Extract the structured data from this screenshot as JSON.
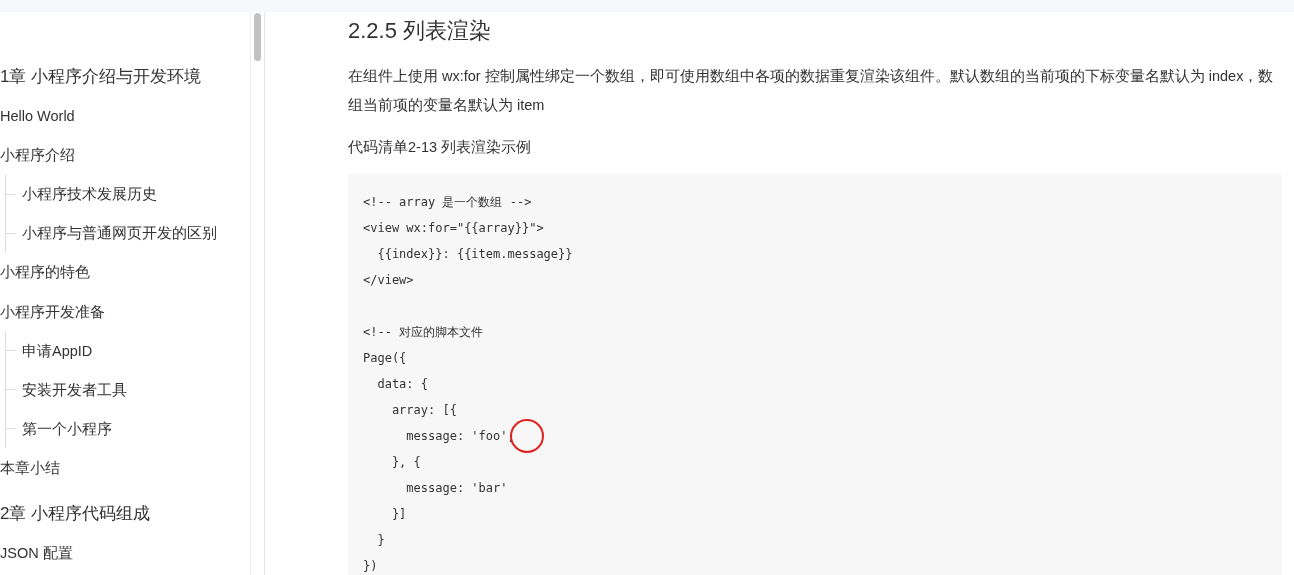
{
  "sidebar": {
    "items": [
      {
        "kind": "chapter",
        "label": "1章 小程序介绍与开发环境"
      },
      {
        "kind": "section",
        "label": "Hello World"
      },
      {
        "kind": "section",
        "label": "小程序介绍",
        "children": [
          {
            "label": "小程序技术发展历史"
          },
          {
            "label": "小程序与普通网页开发的区别"
          }
        ]
      },
      {
        "kind": "section",
        "label": "小程序的特色"
      },
      {
        "kind": "section",
        "label": "小程序开发准备",
        "children": [
          {
            "label": "申请AppID"
          },
          {
            "label": "安装开发者工具"
          },
          {
            "label": "第一个小程序"
          }
        ]
      },
      {
        "kind": "section",
        "label": "本章小结"
      },
      {
        "kind": "chapter",
        "label": "2章 小程序代码组成"
      },
      {
        "kind": "section",
        "label": "JSON 配置"
      }
    ]
  },
  "content": {
    "heading": "2.2.5 列表渲染",
    "paragraph": "在组件上使用 wx:for 控制属性绑定一个数组，即可使用数组中各项的数据重复渲染该组件。默认数组的当前项的下标变量名默认为 index，数组当前项的变量名默认为 item",
    "caption": "代码清单2-13 列表渲染示例",
    "code_blocks": [
      [
        "<!-- array 是一个数组 -->",
        "<view wx:for=\"{{array}}\">",
        "  {{index}}: {{item.message}}",
        "</view>"
      ],
      [
        "<!-- 对应的脚本文件",
        "Page({",
        "  data: {",
        "    array: [{",
        "      message: 'foo',",
        "    }, {",
        "      message: 'bar'",
        "    }]",
        "  }",
        "})"
      ]
    ]
  }
}
